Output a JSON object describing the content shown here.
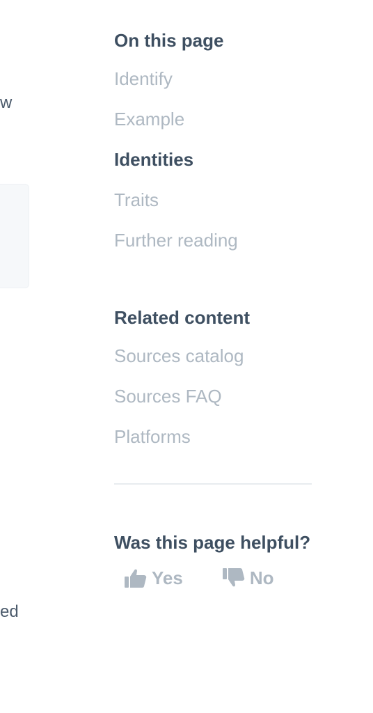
{
  "left_fragments": {
    "line1": "w",
    "line2": "ed"
  },
  "on_this_page": {
    "title": "On this page",
    "items": [
      {
        "label": "Identify",
        "active": false
      },
      {
        "label": "Example",
        "active": false
      },
      {
        "label": "Identities",
        "active": true
      },
      {
        "label": "Traits",
        "active": false
      },
      {
        "label": "Further reading",
        "active": false
      }
    ]
  },
  "related_content": {
    "title": "Related content",
    "items": [
      {
        "label": "Sources catalog"
      },
      {
        "label": "Sources FAQ"
      },
      {
        "label": "Platforms"
      }
    ]
  },
  "feedback": {
    "title": "Was this page helpful?",
    "yes_label": "Yes",
    "no_label": "No",
    "yes_icon": "thumbs-up-icon",
    "no_icon": "thumbs-down-icon"
  },
  "colors": {
    "heading": "#3e4f61",
    "muted": "#aeb8c2",
    "divider": "#e8ecef"
  }
}
